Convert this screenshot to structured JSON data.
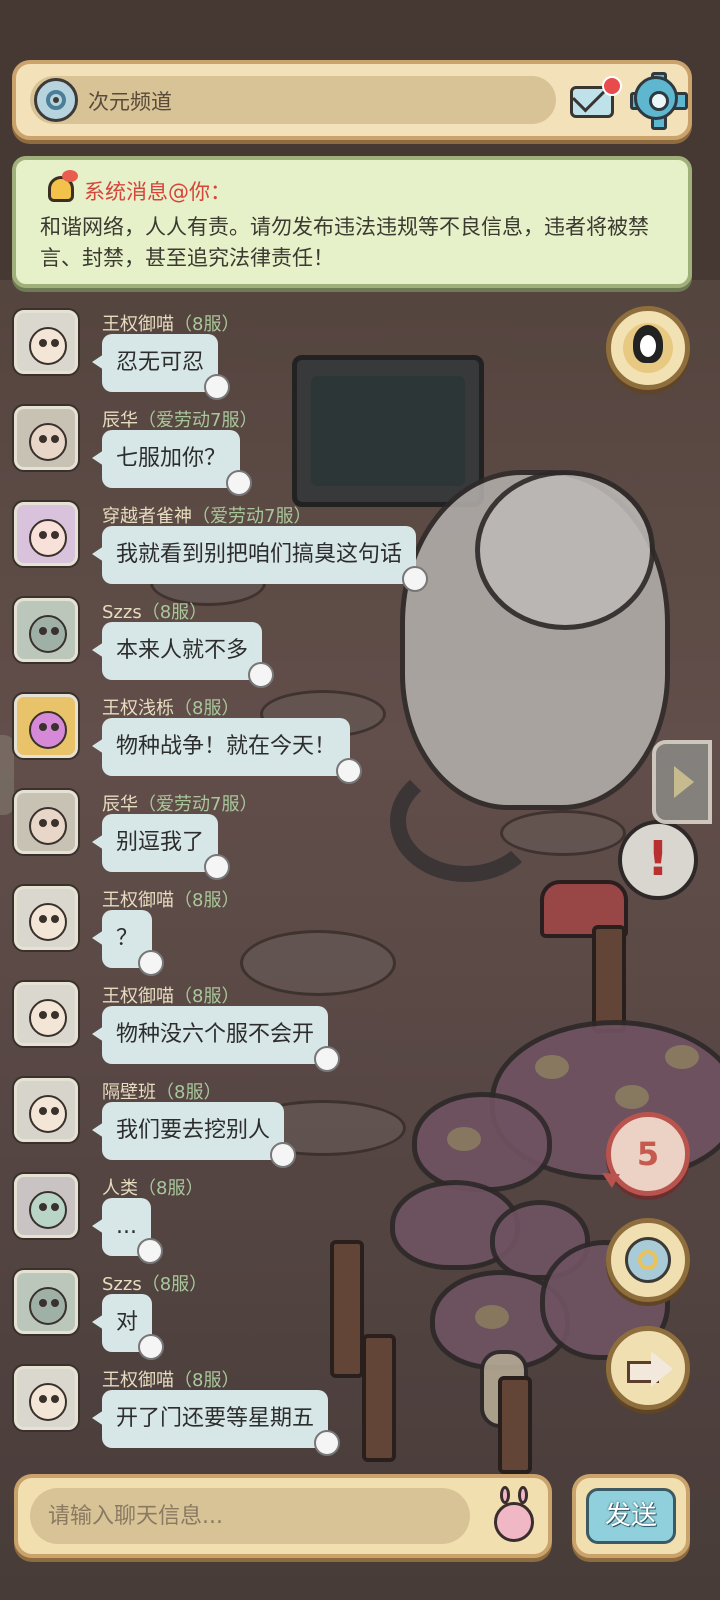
{
  "header": {
    "channel_label": "次元频道",
    "channel_icon": "portal-icon",
    "mail_icon": "mail-icon",
    "settings_icon": "gear-icon"
  },
  "notice": {
    "title": "系统消息@你：",
    "body": "和谐网络，人人有责。请勿发布违法违规等不良信息，违者将被禁言、封禁，甚至追究法律责任！"
  },
  "messages": [
    {
      "name": "王权御喵",
      "server": "（8服）",
      "text": "忍无可忍",
      "avatar": "glasses"
    },
    {
      "name": "辰华",
      "server": "（爱劳动7服）",
      "text": "七服加你？",
      "avatar": "snail"
    },
    {
      "name": "穿越者雀神",
      "server": "（爱劳动7服）",
      "text": "我就看到别把咱们搞臭这句话",
      "avatar": "pink"
    },
    {
      "name": "Szzs",
      "server": "（8服）",
      "text": "本来人就不多",
      "avatar": "green"
    },
    {
      "name": "王权浅栎",
      "server": "（8服）",
      "text": "物种战争！就在今天！",
      "avatar": "purple"
    },
    {
      "name": "辰华",
      "server": "（爱劳动7服）",
      "text": "别逗我了",
      "avatar": "snail"
    },
    {
      "name": "王权御喵",
      "server": "（8服）",
      "text": "？",
      "avatar": "glasses"
    },
    {
      "name": "王权御喵",
      "server": "（8服）",
      "text": "物种没六个服不会开",
      "avatar": "glasses"
    },
    {
      "name": "隔壁班",
      "server": "（8服）",
      "text": "我们要去挖别人",
      "avatar": "boy"
    },
    {
      "name": "人类",
      "server": "（8服）",
      "text": "...",
      "avatar": "girl"
    },
    {
      "name": "Szzs",
      "server": "（8服）",
      "text": "对",
      "avatar": "green"
    },
    {
      "name": "王权御喵",
      "server": "（8服）",
      "text": "开了门还要等星期五",
      "avatar": "glasses"
    }
  ],
  "side": {
    "count_badge": "5"
  },
  "input": {
    "placeholder": "请输入聊天信息...",
    "value": ""
  },
  "send_label": "发送",
  "colors": {
    "panel": "#f3e1b9",
    "notice_bg": "#e6f0c9",
    "notice_title": "#d6453a",
    "bubble": "#d7e6e6",
    "server_tag": "#a9c79a",
    "name": "#e6dcbf"
  }
}
